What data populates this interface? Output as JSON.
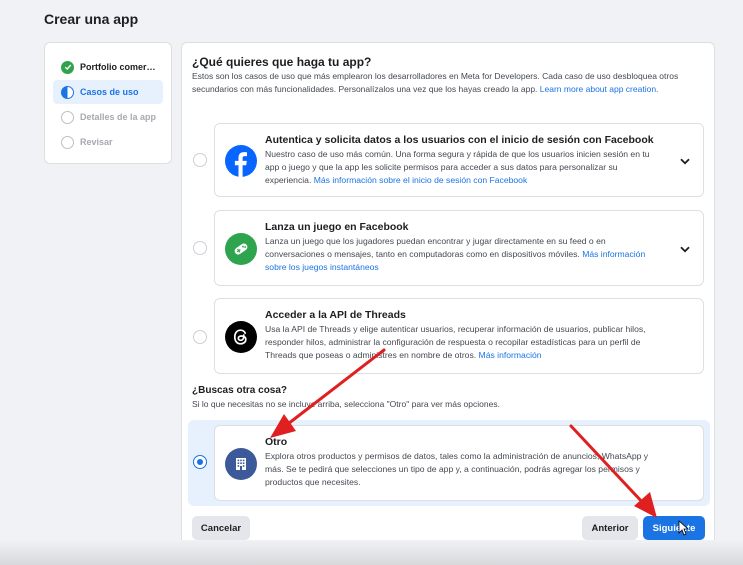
{
  "page": {
    "title": "Crear una app"
  },
  "steps": [
    {
      "label": "Portfolio comer…",
      "state": "done"
    },
    {
      "label": "Casos de uso",
      "state": "active"
    },
    {
      "label": "Detalles de la app",
      "state": "todo"
    },
    {
      "label": "Revisar",
      "state": "todo"
    }
  ],
  "main": {
    "title": "¿Qué quieres que haga tu app?",
    "intro": "Estos son los casos de uso que más emplearon los desarrolladores en Meta for Developers. Cada caso de uso desbloquea otros secundarios con más funcionalidades. Personalízalos una vez que los hayas creado la app.",
    "intro_link": "Learn more about app creation."
  },
  "cards": [
    {
      "title": "Autentica y solicita datos a los usuarios con el inicio de sesión con Facebook",
      "desc": "Nuestro caso de uso más común. Una forma segura y rápida de que los usuarios inicien sesión en tu app o juego y que la app les solicite permisos para acceder a sus datos para personalizar su experiencia.",
      "link": "Más información sobre el inicio de sesión con Facebook",
      "icon": "facebook-icon"
    },
    {
      "title": "Lanza un juego en Facebook",
      "desc": "Lanza un juego que los jugadores puedan encontrar y jugar directamente en su feed o en conversaciones o mensajes, tanto en computadoras como en dispositivos móviles.",
      "link": "Más información sobre los juegos instantáneos",
      "icon": "game-controller-icon"
    },
    {
      "title": "Acceder a la API de Threads",
      "desc": "Usa la API de Threads y elige autenticar usuarios, recuperar información de usuarios, publicar hilos, responder hilos, administrar la configuración de respuesta o recopilar estadísticas para un perfil de Threads que poseas o administres en nombre de otros.",
      "link": "Más información",
      "icon": "threads-icon"
    }
  ],
  "other_section": {
    "title": "¿Buscas otra cosa?",
    "subtitle": "Si lo que necesitas no se incluye arriba, selecciona \"Otro\" para ver más opciones.",
    "card_title": "Otro",
    "card_desc": "Explora otros productos y permisos de datos, tales como la administración de anuncios, WhatsApp y más. Se te pedirá que selecciones un tipo de app y, a continuación, podrás agregar los permisos y productos que necesites.",
    "icon": "building-icon",
    "selected": true
  },
  "footer": {
    "cancel": "Cancelar",
    "back": "Anterior",
    "next": "Siguiente"
  },
  "colors": {
    "accent": "#1b74e4",
    "arrow": "#e02020",
    "success": "#31a24c"
  }
}
